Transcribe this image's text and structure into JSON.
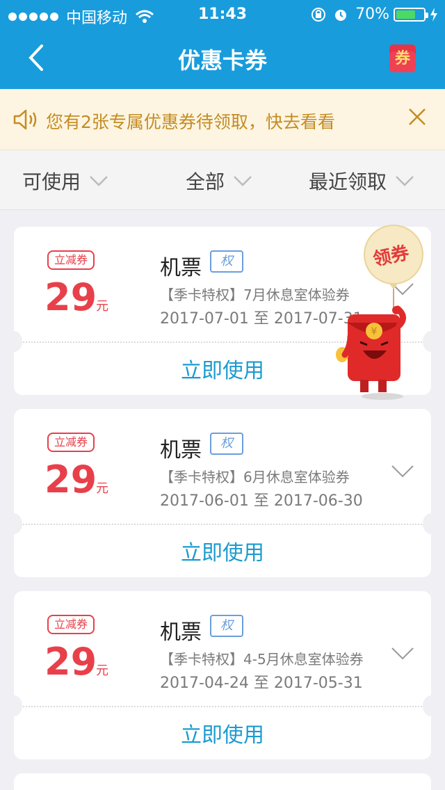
{
  "status_bar": {
    "carrier": "中国移动",
    "time": "11:43",
    "battery": "70%",
    "battery_level": 0.7
  },
  "nav": {
    "title": "优惠卡券",
    "coupon_icon_label": "券"
  },
  "notice": {
    "text": "您有2张专属优惠券待领取，快去看看"
  },
  "filters": [
    {
      "label": "可使用"
    },
    {
      "label": "全部"
    },
    {
      "label": "最近领取"
    }
  ],
  "coupons": [
    {
      "tag": "立减券",
      "amount": "29",
      "unit": "元",
      "title": "机票",
      "badge": "权",
      "desc": "【季卡特权】7月休息室体验券",
      "date": "2017-07-01 至 2017-07-31",
      "action": "立即使用"
    },
    {
      "tag": "立减券",
      "amount": "29",
      "unit": "元",
      "title": "机票",
      "badge": "权",
      "desc": "【季卡特权】6月休息室体验券",
      "date": "2017-06-01 至 2017-06-30",
      "action": "立即使用"
    },
    {
      "tag": "立减券",
      "amount": "29",
      "unit": "元",
      "title": "机票",
      "badge": "权",
      "desc": "【季卡特权】4-5月休息室体验券",
      "date": "2017-04-24 至 2017-05-31",
      "action": "立即使用"
    }
  ],
  "promo": {
    "balloon_text": "领券"
  },
  "colors": {
    "header_bg": "#199cdc",
    "accent_red": "#e8404a",
    "link_blue": "#1b9bcf",
    "notice_text": "#c48c23"
  }
}
